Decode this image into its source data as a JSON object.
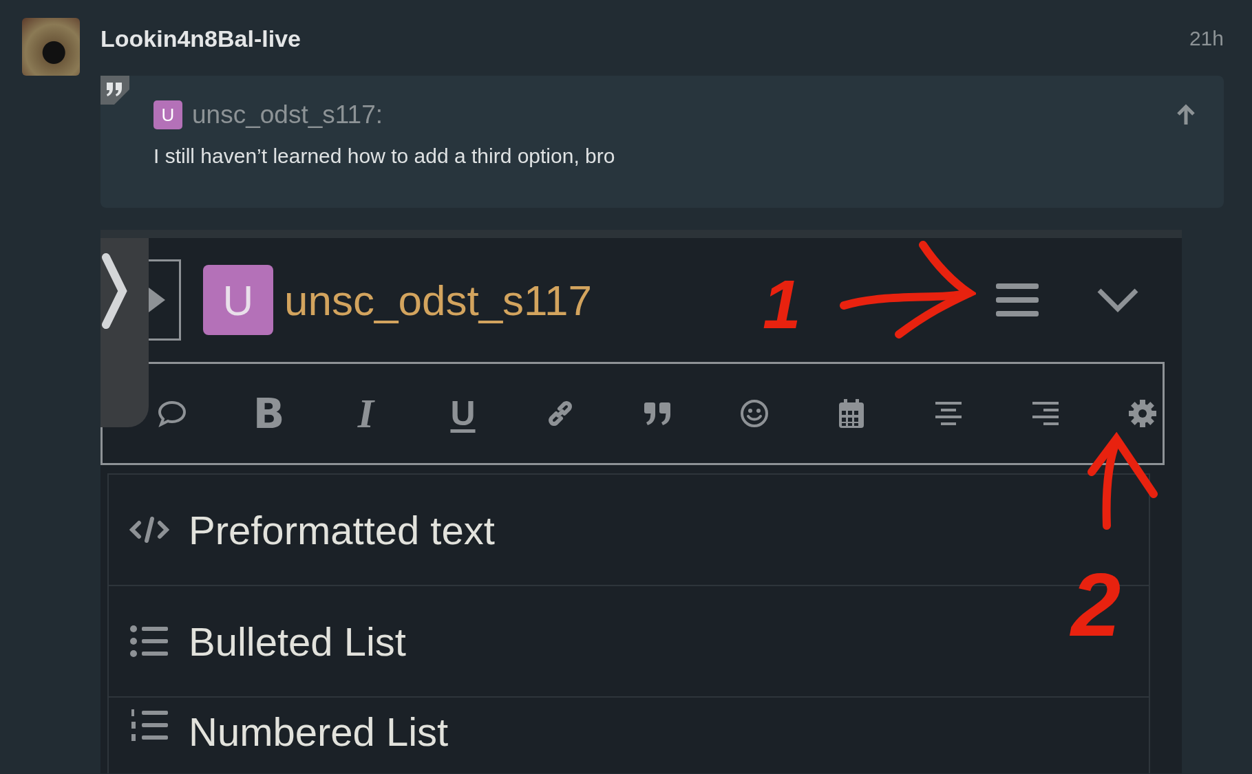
{
  "post": {
    "author": "Lookin4n8Bal-live",
    "time": "21h",
    "quote": {
      "avatar_letter": "U",
      "author": "unsc_odst_s117:",
      "text": "I still haven’t learned how to add a third option, bro"
    },
    "screenshot": {
      "user": {
        "avatar_letter": "U",
        "name": "unsc_odst_s117"
      },
      "toolbar": [
        {
          "kind": "chat"
        },
        {
          "kind": "bold",
          "glyph": "B"
        },
        {
          "kind": "italic",
          "glyph": "I"
        },
        {
          "kind": "underline",
          "glyph": "U"
        },
        {
          "kind": "link"
        },
        {
          "kind": "quote"
        },
        {
          "kind": "emoji"
        },
        {
          "kind": "calendar"
        },
        {
          "kind": "align-center"
        },
        {
          "kind": "align-right"
        },
        {
          "kind": "gear"
        }
      ],
      "menu_items": [
        {
          "kind": "code",
          "label": "Preformatted text"
        },
        {
          "kind": "bullets",
          "label": "Bulleted List"
        },
        {
          "kind": "numbers",
          "label": "Numbered List"
        }
      ],
      "annotations": [
        {
          "label": "1"
        },
        {
          "label": "2"
        }
      ]
    }
  }
}
